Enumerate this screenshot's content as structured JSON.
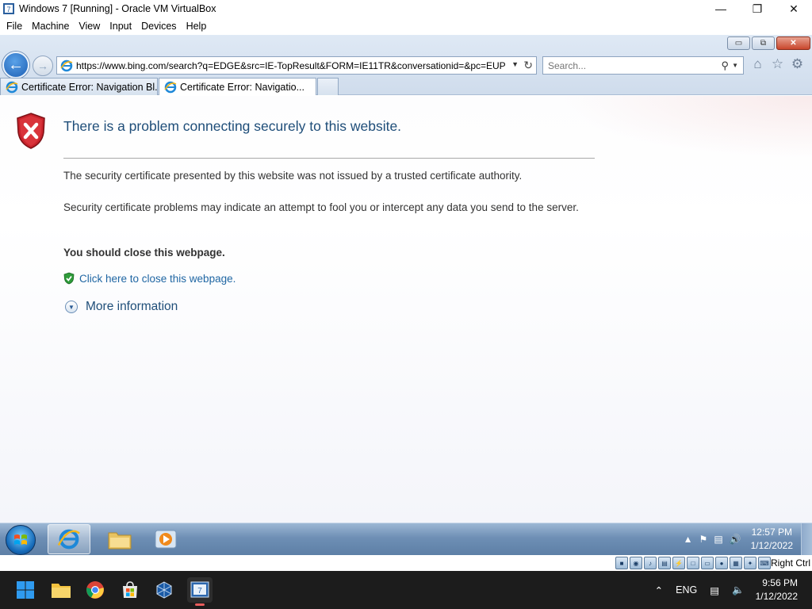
{
  "vbox": {
    "title": "Windows 7 [Running] - Oracle VM VirtualBox",
    "window_buttons": [
      "—",
      "❐",
      "✕"
    ],
    "menu": [
      "File",
      "Machine",
      "View",
      "Input",
      "Devices",
      "Help"
    ],
    "status": {
      "host_key": "Right Ctrl"
    }
  },
  "ie": {
    "caption_buttons": [
      "▭",
      "⧉",
      "✕"
    ],
    "address": {
      "url": "https://www.bing.com/search?q=EDGE&src=IE-TopResult&FORM=IE11TR&conversationid=&pc=EUP"
    },
    "search": {
      "placeholder": "Search..."
    },
    "tabs": [
      {
        "label": "Certificate Error: Navigation Bl..."
      },
      {
        "label": "Certificate Error: Navigatio..."
      }
    ]
  },
  "page": {
    "heading": "There is a problem connecting securely to this website.",
    "para1": "The security certificate presented by this website was not issued by a trusted certificate authority.",
    "para2": "Security certificate problems may indicate an attempt to fool you or intercept any data you send to the server.",
    "recommendation": "You should close this webpage.",
    "close_link": "Click here to close this webpage.",
    "more_info": "More information"
  },
  "win7": {
    "clock": {
      "time": "12:57 PM",
      "date": "1/12/2022"
    }
  },
  "host": {
    "tray": {
      "language": "ENG"
    },
    "clock": {
      "time": "9:56 PM",
      "date": "1/12/2022"
    }
  },
  "colors": {
    "link": "#1f66a3",
    "heading": "#1f4e79",
    "error_red": "#c8232c"
  }
}
